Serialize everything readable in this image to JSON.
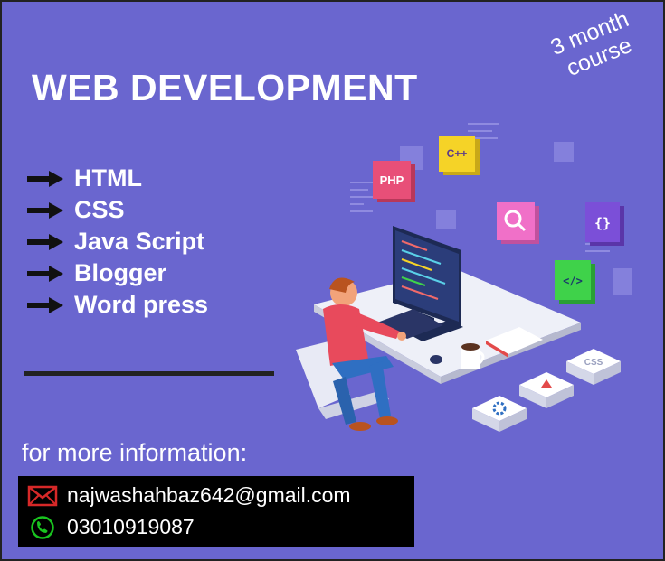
{
  "poster": {
    "title": "WEB DEVELOPMENT",
    "badge_line1": "3 month",
    "badge_line2": "course",
    "courses": [
      {
        "label": "HTML"
      },
      {
        "label": "CSS"
      },
      {
        "label": "Java Script"
      },
      {
        "label": "Blogger"
      },
      {
        "label": "Word press"
      }
    ],
    "info_heading": "for more information:",
    "contact": {
      "email": "najwashahbaz642@gmail.com",
      "phone": "03010919087"
    },
    "illustration": {
      "tiles": [
        "PHP",
        "C++",
        "{}",
        "</>",
        "CSS"
      ]
    }
  },
  "colors": {
    "background": "#6a66cf",
    "text": "#ffffff",
    "contact_box": "#000000",
    "email_icon": "#d62828",
    "phone_icon": "#19c31f",
    "php_tile": "#e84f78",
    "cpp_tile": "#f5d327",
    "search_tile": "#f070c8",
    "braces_tile": "#7b4fd8",
    "code_tile": "#3fd24a"
  },
  "icons": {
    "list_marker": "arrow-right-icon",
    "email": "envelope-icon",
    "phone": "phone-icon"
  }
}
